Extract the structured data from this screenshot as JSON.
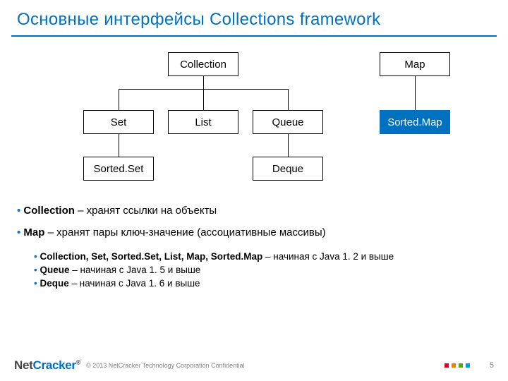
{
  "title": "Основные интерфейсы Collections framework",
  "diagram": {
    "nodes": {
      "collection": "Collection",
      "map": "Map",
      "set": "Set",
      "list": "List",
      "queue": "Queue",
      "sortedmap": "Sorted.Map",
      "sortedset": "Sorted.Set",
      "deque": "Deque"
    }
  },
  "bullets": {
    "collection_term": "Collection",
    "collection_desc": " – хранят ссылки на объекты",
    "map_term": "Map",
    "map_desc": " – хранят пары ключ-значение (ассоциативные массивы)",
    "s1_terms": "Collection, Set, Sorted.Set, List, Map, Sorted.Map",
    "s1_desc": " – начиная с Java 1. 2 и выше",
    "s2_terms": "Queue",
    "s2_desc": " – начиная с Java 1. 5 и выше",
    "s3_terms": "Deque",
    "s3_desc": " – начиная с Java 1. 6 и выше"
  },
  "footer": {
    "logo_a": "Net",
    "logo_b": "Cracker",
    "copyright": "© 2013 NetCracker Technology Corporation Confidential",
    "pagenum": "5",
    "dot_colors": [
      "#e2001a",
      "#ef7d00",
      "#5ea215",
      "#009ee0"
    ]
  },
  "chart_data": {
    "type": "tree",
    "roots": [
      {
        "name": "Collection",
        "children": [
          {
            "name": "Set",
            "children": [
              {
                "name": "Sorted.Set"
              }
            ]
          },
          {
            "name": "List"
          },
          {
            "name": "Queue",
            "children": [
              {
                "name": "Deque"
              }
            ]
          }
        ]
      },
      {
        "name": "Map",
        "children": [
          {
            "name": "Sorted.Map"
          }
        ]
      }
    ]
  }
}
